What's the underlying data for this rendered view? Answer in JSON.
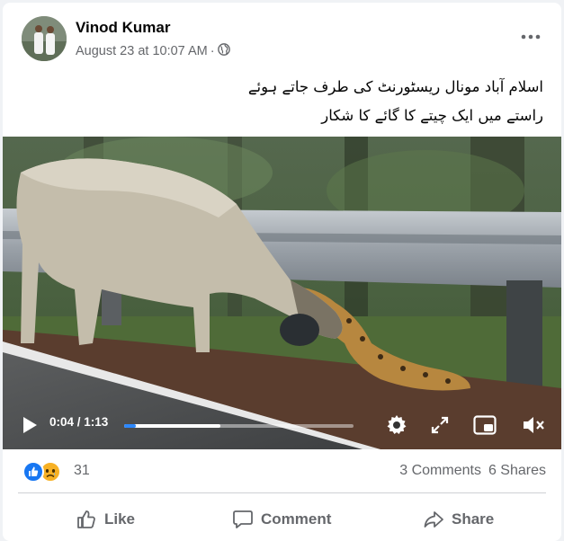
{
  "post": {
    "author": "Vinod Kumar",
    "date": "August 23 at 10:07 AM",
    "meta_separator": "·",
    "privacy_icon": "globe-icon",
    "more_icon": "more-horizontal-icon",
    "caption_lines": [
      "اسلام آباد مونال ریسٹورنٹ کی طرف جاتے ہوئے",
      "راستے میں ایک چیتے کا گائے کا شکار"
    ]
  },
  "video": {
    "current_time": "0:04",
    "duration": "1:13",
    "time_separator": " / ",
    "progress_played": 0.05,
    "progress_buffered": 0.42,
    "accent_color": "#2d88ff",
    "icons": [
      "play-icon",
      "settings-gear-icon",
      "fullscreen-expand-icon",
      "picture-in-picture-icon",
      "volume-muted-icon"
    ]
  },
  "stats": {
    "reaction_icons": [
      "like-reaction-icon",
      "sad-reaction-icon"
    ],
    "reaction_count": "31",
    "comments": "3 Comments",
    "shares": "6 Shares"
  },
  "actions": {
    "like": "Like",
    "comment": "Comment",
    "share": "Share"
  },
  "colors": {
    "brand_blue": "#1877f2",
    "secondary_text": "#65676b",
    "background": "#f0f2f5"
  }
}
